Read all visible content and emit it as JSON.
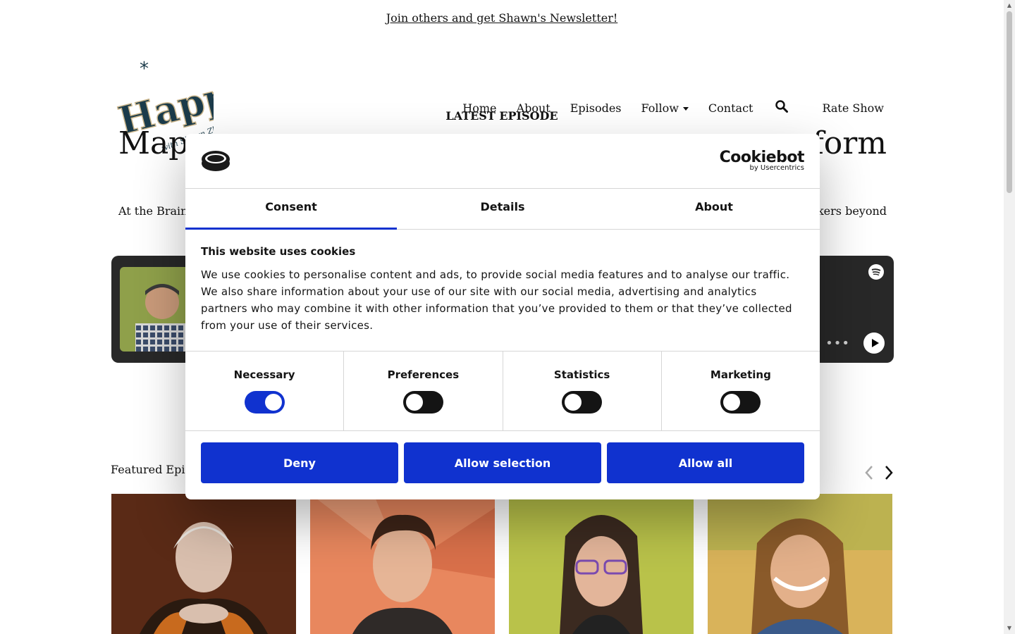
{
  "site": {
    "newsletter_link": "Join others and get Shawn's Newsletter!",
    "nav": {
      "home": "Home",
      "about": "About",
      "episodes": "Episodes",
      "follow": "Follow",
      "contact": "Contact",
      "rate": "Rate Show"
    },
    "latest_label": "LATEST EPISODE",
    "hero_title_left": "Mapp",
    "hero_title_right": "sform",
    "intro_left": "At the Brain a",
    "intro_right": "akers beyond",
    "player_dots": "•••",
    "featured_label": "Featured Episo"
  },
  "cookie": {
    "brand_name": "Cookiebot",
    "brand_sub": "by Usercentrics",
    "tabs": [
      "Consent",
      "Details",
      "About"
    ],
    "active_tab": "Consent",
    "title": "This website uses cookies",
    "text": "We use cookies to personalise content and ads, to provide social media features and to analyse our traffic. We also share information about your use of our site with our social media, advertising and analytics partners who may combine it with other information that you’ve provided to them or that they’ve collected from your use of their services.",
    "toggles": [
      {
        "label": "Necessary",
        "on": true
      },
      {
        "label": "Preferences",
        "on": false
      },
      {
        "label": "Statistics",
        "on": false
      },
      {
        "label": "Marketing",
        "on": false
      }
    ],
    "buttons": {
      "deny": "Deny",
      "allow_selection": "Allow selection",
      "allow_all": "Allow all"
    },
    "accent": "#1032cf"
  }
}
